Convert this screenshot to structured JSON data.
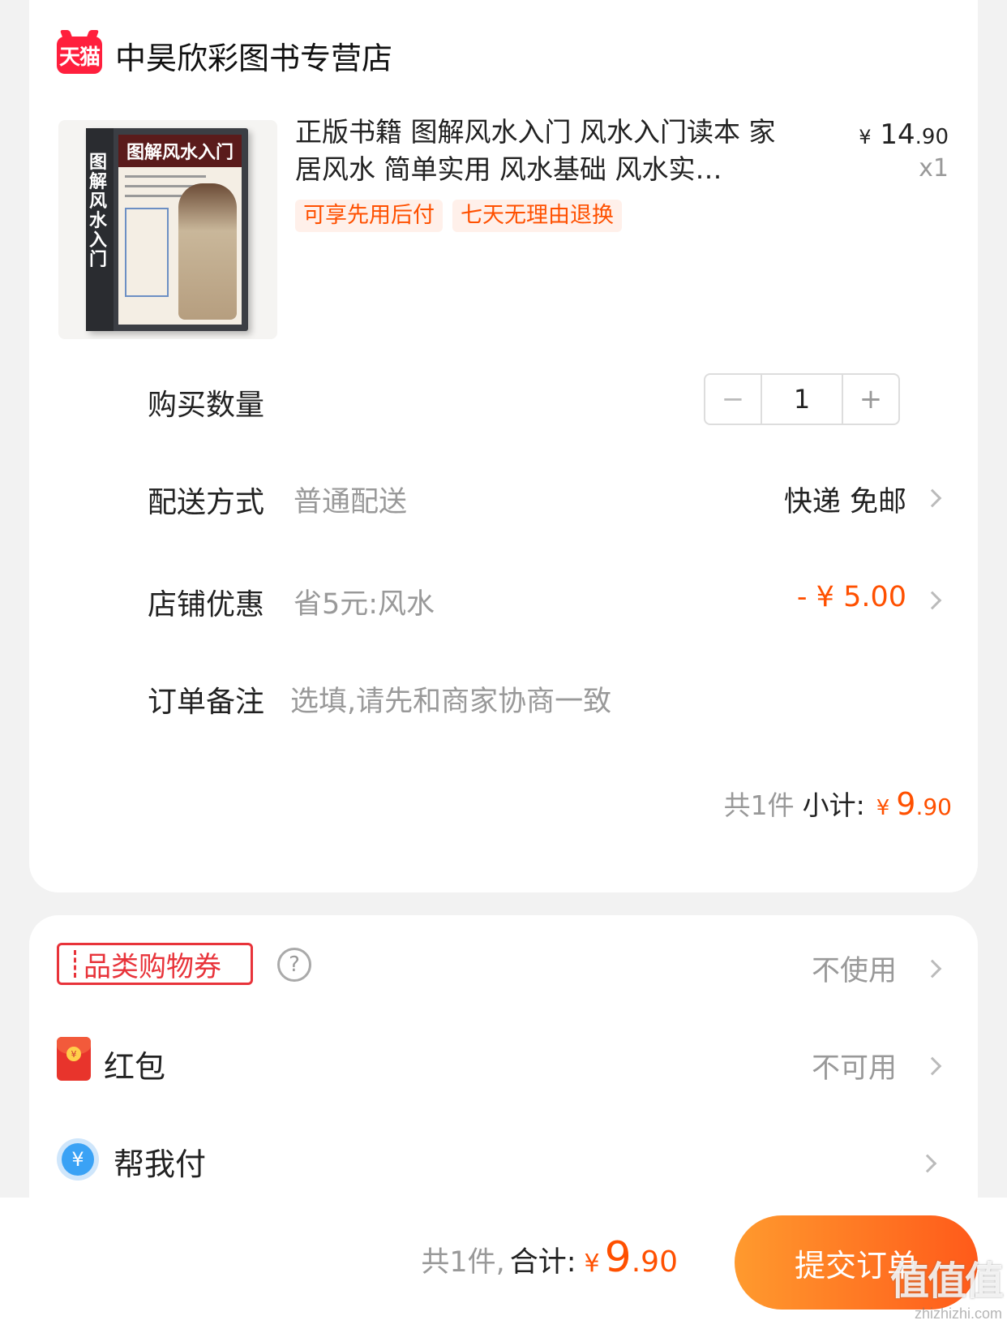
{
  "store": {
    "logo_text": "天猫",
    "name": "中昊欣彩图书专营店"
  },
  "product": {
    "title": "正版书籍 图解风水入门 风水入门读本 家居风水 简单实用 风水基础 风水实…",
    "cover_title": "图解风水入门",
    "price_currency": "¥",
    "price_int": "14",
    "price_dec": ".90",
    "quantity_label": "x1",
    "tags": [
      "可享先用后付",
      "七天无理由退换"
    ]
  },
  "order": {
    "quantity": {
      "label": "购买数量",
      "value": "1",
      "minus": "−",
      "plus": "+"
    },
    "delivery": {
      "label": "配送方式",
      "sub": "普通配送",
      "value": "快递 免邮"
    },
    "discount": {
      "label": "店铺优惠",
      "sub": "省5元:风水",
      "value": "- ¥ 5.00"
    },
    "note": {
      "label": "订单备注",
      "placeholder": "选填,请先和商家协商一致"
    },
    "subtotal": {
      "count_text": "共1件",
      "label": "小计:",
      "currency": "¥",
      "int": "9",
      "dec": ".90"
    }
  },
  "payment": {
    "coupon": {
      "label": "品类购物券",
      "help": "?",
      "value": "不使用"
    },
    "red_packet": {
      "label": "红包",
      "value": "不可用",
      "coin": "¥"
    },
    "help_pay": {
      "label": "帮我付",
      "icon_text": "¥"
    }
  },
  "bottom": {
    "count_text": "共1件,",
    "label": "合计:",
    "currency": "¥",
    "int": "9",
    "dec": ".90",
    "submit": "提交订单"
  },
  "watermark": {
    "big": "值值值",
    "small": "zhizhizhi.com"
  },
  "colors": {
    "accent": "#ff5000",
    "tmall_red": "#ff1f3d",
    "coupon_red": "#e8333a"
  }
}
